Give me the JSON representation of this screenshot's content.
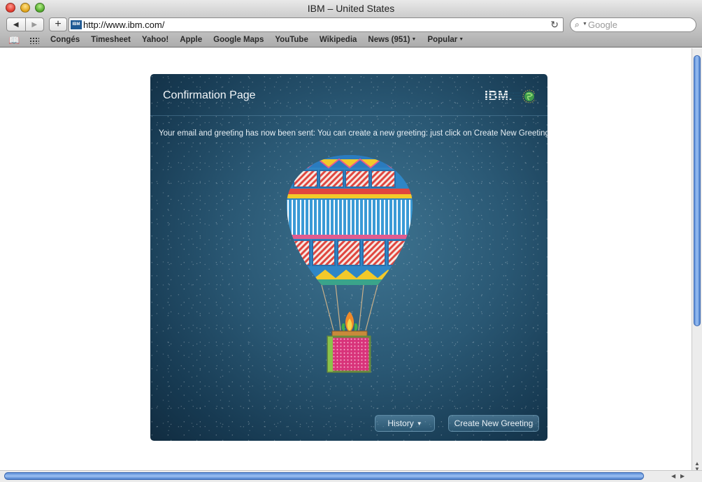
{
  "window": {
    "title": "IBM – United States"
  },
  "toolbar": {
    "url": "http://www.ibm.com/",
    "favicon_text": "IBM",
    "search_placeholder": "Google",
    "back_icon": "back-arrow-icon",
    "forward_icon": "forward-arrow-icon",
    "add_icon": "plus-icon",
    "reload_icon": "reload-icon"
  },
  "bookmarks": {
    "items": [
      {
        "label": "Congés"
      },
      {
        "label": "Timesheet"
      },
      {
        "label": "Yahoo!"
      },
      {
        "label": "Apple"
      },
      {
        "label": "Google Maps"
      },
      {
        "label": "YouTube"
      },
      {
        "label": "Wikipedia"
      },
      {
        "label": "News (951)",
        "menu": true
      },
      {
        "label": "Popular",
        "menu": true
      }
    ]
  },
  "card": {
    "title": "Confirmation Page",
    "logo_text": "IBM.",
    "message": "Your email and greeting has now been sent: You can create a new greeting: just click on Create New Greeting",
    "history_label": "History",
    "create_label": "Create New Greeting"
  },
  "colors": {
    "card_bg": "#2a5874",
    "accent_blue": "#5d8fd8"
  }
}
